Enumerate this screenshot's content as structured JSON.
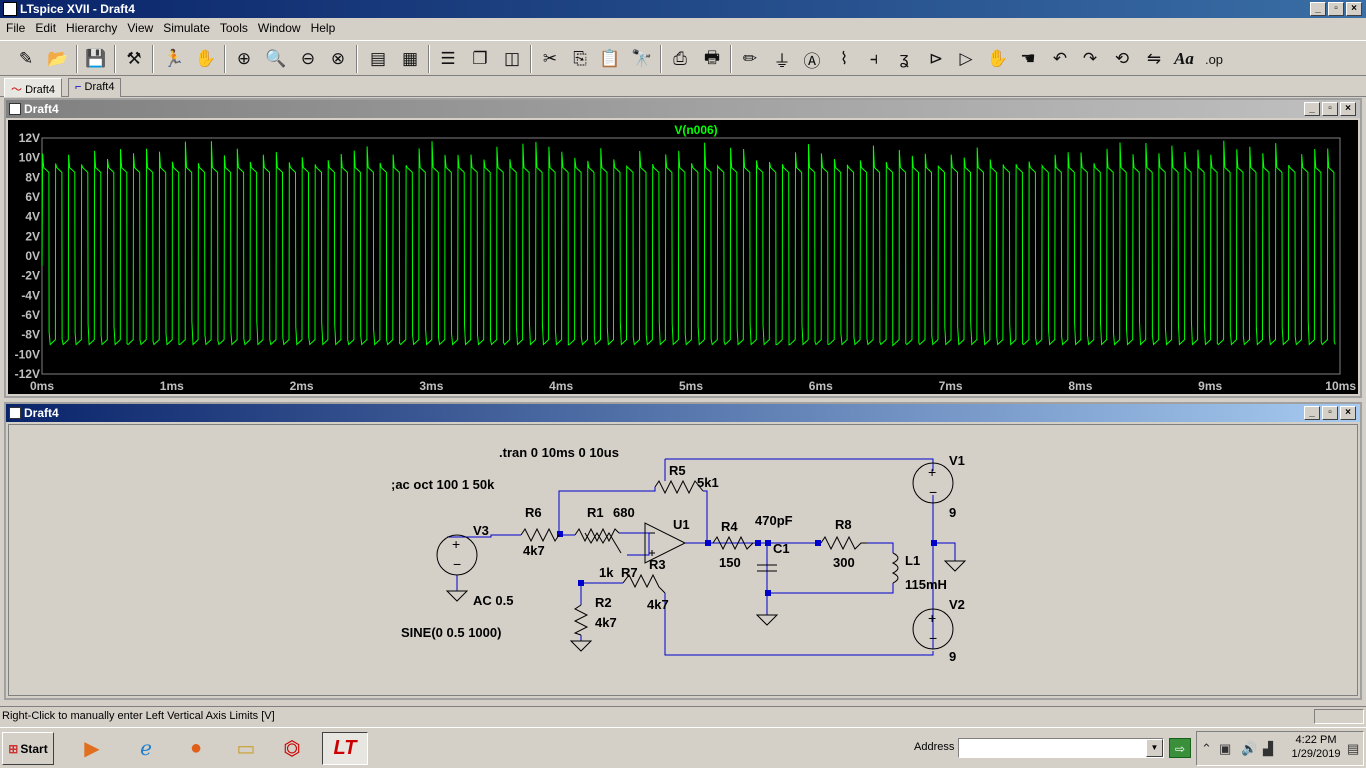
{
  "window": {
    "title": "LTspice XVII - Draft4"
  },
  "menu": [
    "File",
    "Edit",
    "Hierarchy",
    "View",
    "Simulate",
    "Tools",
    "Window",
    "Help"
  ],
  "toolbar": {
    "icons": [
      "new-schematic-icon",
      "open-icon",
      "save-icon",
      "control-panel-icon",
      "run-icon",
      "halt-icon",
      "zoom-in-icon",
      "zoom-full-icon",
      "zoom-out-icon",
      "zoom-cancel-icon",
      "autorange-icon",
      "view-fft-icon",
      "tile-horizontal-icon",
      "cascade-icon",
      "tile-vertical-icon",
      "cut-icon",
      "copy-icon",
      "paste-icon",
      "find-icon",
      "print-setup-icon",
      "print-icon",
      "draw-wire-icon",
      "ground-icon",
      "label-net-icon",
      "resistor-icon",
      "capacitor-icon",
      "inductor-icon",
      "diode-icon",
      "component-icon",
      "move-icon",
      "drag-icon",
      "undo-icon",
      "redo-icon",
      "rotate-icon",
      "mirror-icon",
      "text-icon",
      "spice-directive-icon"
    ],
    "text_text": "Aa",
    "directive_text": ".op"
  },
  "tabs": [
    {
      "label": "Draft4",
      "icon": "waveform-icon",
      "active": true
    },
    {
      "label": "Draft4",
      "icon": "schematic-icon",
      "active": false
    }
  ],
  "plot_window": {
    "title": "Draft4",
    "chart_data": {
      "type": "line",
      "title": "V(n006)",
      "xlabel": "",
      "ylabel": "",
      "x_ticks": [
        "0ms",
        "1ms",
        "2ms",
        "3ms",
        "4ms",
        "5ms",
        "6ms",
        "7ms",
        "8ms",
        "9ms",
        "10ms"
      ],
      "y_ticks": [
        "12V",
        "10V",
        "8V",
        "6V",
        "4V",
        "2V",
        "0V",
        "-2V",
        "-4V",
        "-6V",
        "-8V",
        "-10V",
        "-12V"
      ],
      "xlim": [
        0,
        10
      ],
      "ylim": [
        -12,
        12
      ],
      "series": [
        {
          "name": "V(n006)",
          "color": "#00ff00",
          "description_values": {
            "period_ms": 0.1,
            "high_v": 8.8,
            "low_v": -8.8,
            "peak_max_v": 11.5,
            "peak_min_v": -11.3
          }
        }
      ],
      "grid": false,
      "background": "#000000"
    }
  },
  "schematic_window": {
    "title": "Draft4",
    "directives": [
      ".tran 0 10ms 0 10us",
      ";ac oct 100 1 50k"
    ],
    "components": [
      {
        "ref": "R5",
        "value": "5k1"
      },
      {
        "ref": "R6",
        "value": "4k7"
      },
      {
        "ref": "R1",
        "value": "680"
      },
      {
        "ref": "U1",
        "value": ""
      },
      {
        "ref": "R4",
        "value": "150"
      },
      {
        "ref": "C1",
        "value": "470pF"
      },
      {
        "ref": "R8",
        "value": "300"
      },
      {
        "ref": "L1",
        "value": "115mH"
      },
      {
        "ref": "V1",
        "value": "9"
      },
      {
        "ref": "V2",
        "value": "9"
      },
      {
        "ref": "V3",
        "value": "AC 0.5"
      },
      {
        "ref": "R7",
        "value": "1k"
      },
      {
        "ref": "R3",
        "value": "4k7"
      },
      {
        "ref": "R2",
        "value": "4k7"
      }
    ],
    "v3_source": "SINE(0 0.5 1000)"
  },
  "status_bar": {
    "message": "Right-Click to manually enter Left Vertical Axis Limits [V]"
  },
  "taskbar": {
    "start_label": "Start",
    "apps": [
      "media-player-icon",
      "internet-explorer-icon",
      "firefox-icon",
      "file-explorer-icon",
      "acrobat-icon",
      "ltspice-icon"
    ],
    "address_label": "Address",
    "address_value": "",
    "time": "4:22 PM",
    "date": "1/29/2019"
  },
  "colors": {
    "trace": "#00ff00",
    "wire": "#0000cc",
    "title_active": "#0a246a"
  }
}
